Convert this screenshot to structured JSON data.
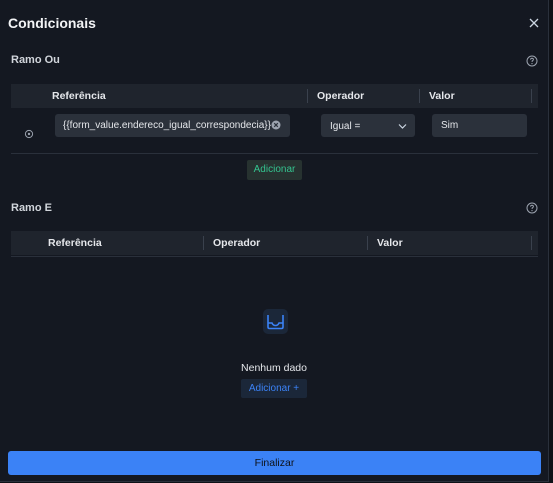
{
  "dialog": {
    "title": "Condicionais",
    "close_icon": "close-icon"
  },
  "ramo_ou": {
    "label": "Ramo Ou",
    "help_icon": "question-circle-icon",
    "headers": {
      "reference": "Referência",
      "operator": "Operador",
      "value": "Valor"
    },
    "rows": [
      {
        "drag_icon": "drag-handle-icon",
        "reference": "{{form_value.endereco_igual_correspondecia}}",
        "operator": "Igual =",
        "value": "Sim"
      }
    ],
    "add_label": "Adicionar"
  },
  "ramo_e": {
    "label": "Ramo E",
    "help_icon": "question-circle-icon",
    "headers": {
      "reference": "Referência",
      "operator": "Operador",
      "value": "Valor"
    },
    "empty_text": "Nenhum dado",
    "empty_icon": "inbox-icon",
    "add_label": "Adicionar +"
  },
  "footer": {
    "finish_label": "Finalizar"
  },
  "colors": {
    "primary": "#3b82f6",
    "success": "#34c38f",
    "background": "#141821"
  }
}
